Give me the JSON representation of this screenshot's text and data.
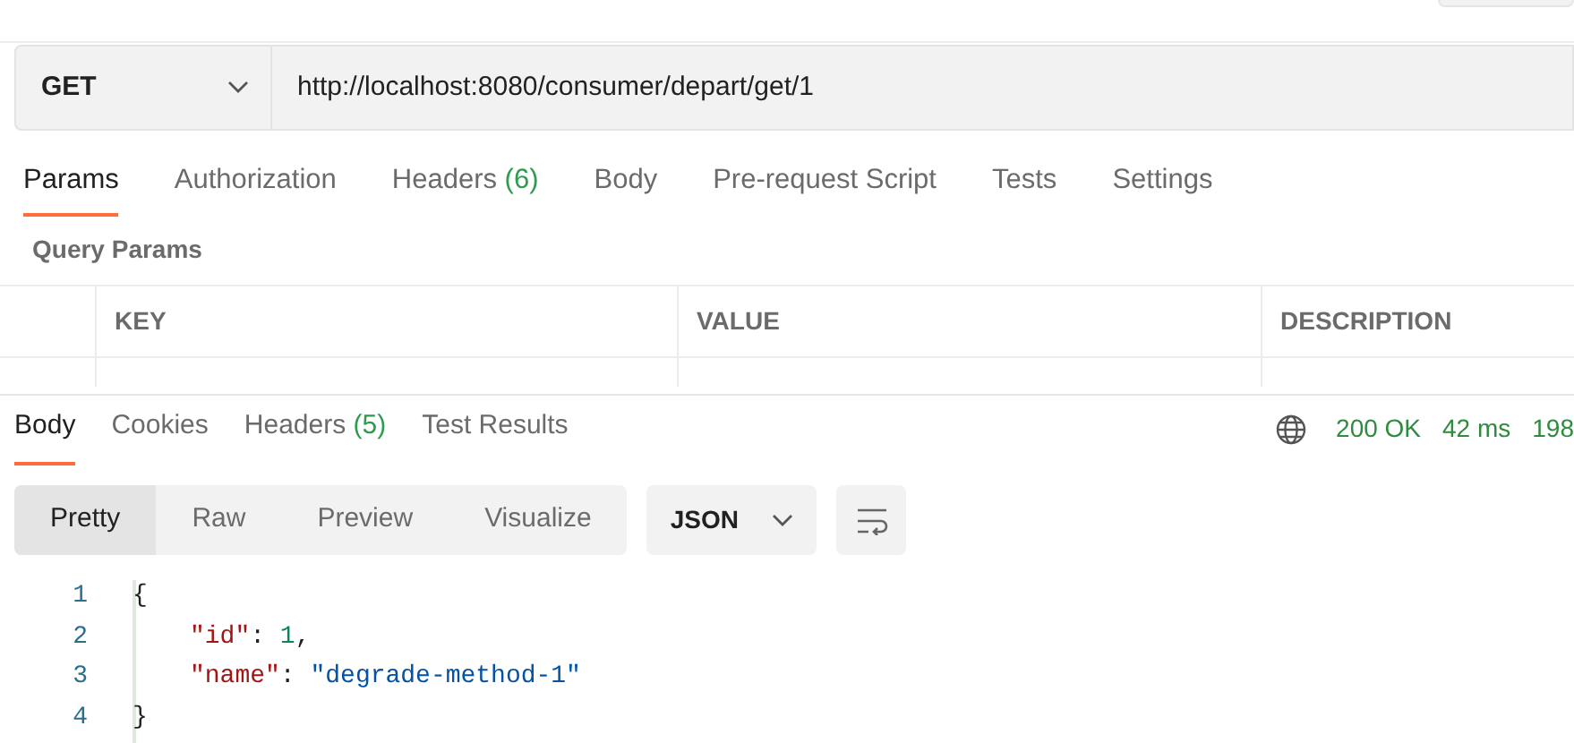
{
  "request": {
    "method": "GET",
    "url": "http://localhost:8080/consumer/depart/get/1"
  },
  "request_tabs": [
    {
      "label": "Params",
      "selected": true
    },
    {
      "label": "Authorization",
      "selected": false
    },
    {
      "label": "Headers",
      "count": "(6)",
      "selected": false
    },
    {
      "label": "Body",
      "selected": false
    },
    {
      "label": "Pre-request Script",
      "selected": false
    },
    {
      "label": "Tests",
      "selected": false
    },
    {
      "label": "Settings",
      "selected": false
    }
  ],
  "query_params": {
    "title": "Query Params",
    "columns": [
      "KEY",
      "VALUE",
      "DESCRIPTION"
    ]
  },
  "response_tabs": [
    {
      "label": "Body",
      "selected": true
    },
    {
      "label": "Cookies",
      "selected": false
    },
    {
      "label": "Headers",
      "count": "(5)",
      "selected": false
    },
    {
      "label": "Test Results",
      "selected": false
    }
  ],
  "status": {
    "code": "200 OK",
    "time": "42 ms",
    "size": "198"
  },
  "view_modes": [
    {
      "label": "Pretty",
      "selected": true
    },
    {
      "label": "Raw",
      "selected": false
    },
    {
      "label": "Preview",
      "selected": false
    },
    {
      "label": "Visualize",
      "selected": false
    }
  ],
  "format": "JSON",
  "code_lines": [
    {
      "number": "1",
      "tokens": [
        {
          "kind": "punct",
          "text": "{"
        }
      ]
    },
    {
      "number": "2",
      "tokens": [
        {
          "kind": "key",
          "text": "\"id\""
        },
        {
          "kind": "punct",
          "text": ": "
        },
        {
          "kind": "number",
          "text": "1"
        },
        {
          "kind": "punct",
          "text": ","
        }
      ]
    },
    {
      "number": "3",
      "tokens": [
        {
          "kind": "key",
          "text": "\"name\""
        },
        {
          "kind": "punct",
          "text": ": "
        },
        {
          "kind": "string",
          "text": "\"degrade-method-1\""
        }
      ]
    },
    {
      "number": "4",
      "tokens": [
        {
          "kind": "punct",
          "text": "}"
        }
      ]
    }
  ]
}
